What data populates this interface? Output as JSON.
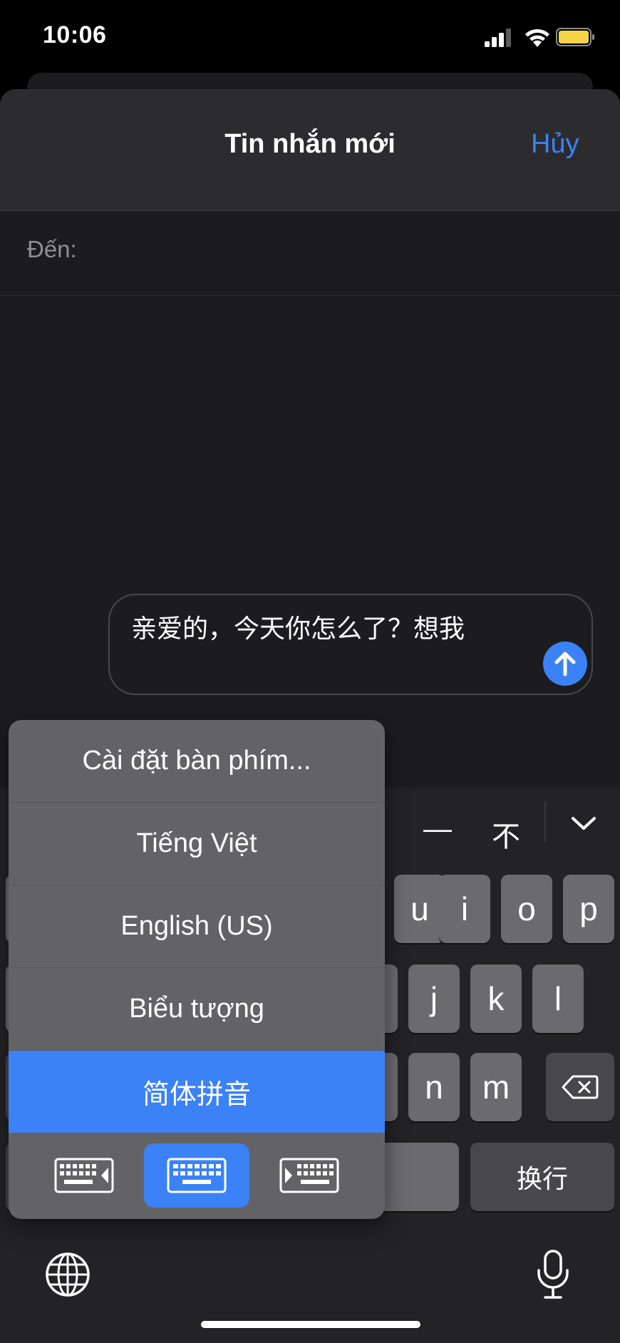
{
  "status_bar": {
    "time": "10:06"
  },
  "sheet": {
    "title": "Tin nhắn mới",
    "cancel_label": "Hủy",
    "to_label": "Đến:"
  },
  "message": {
    "text": "亲爱的，今天你怎么了？想我"
  },
  "keyboard": {
    "candidates": [
      "—",
      "不"
    ],
    "row1_keys": [
      "u",
      "i",
      "o",
      "p"
    ],
    "row2_keys": [
      "j",
      "k",
      "l"
    ],
    "row3_keys": [
      "n",
      "m"
    ],
    "return_label": "换行"
  },
  "language_menu": {
    "items": [
      {
        "label": "Cài đặt bàn phím..."
      },
      {
        "label": "Tiếng Việt"
      },
      {
        "label": "English (US)"
      },
      {
        "label": "Biểu tượng"
      },
      {
        "label": "简体拼音",
        "selected": true
      }
    ],
    "keyboard_modes": [
      {
        "name": "left-keyboard-icon"
      },
      {
        "name": "full-keyboard-icon",
        "selected": true
      },
      {
        "name": "right-keyboard-icon"
      }
    ]
  },
  "colors": {
    "accent": "#3b82f6",
    "sheet_bg": "#1c1c1e",
    "menu_bg": "#636366"
  }
}
